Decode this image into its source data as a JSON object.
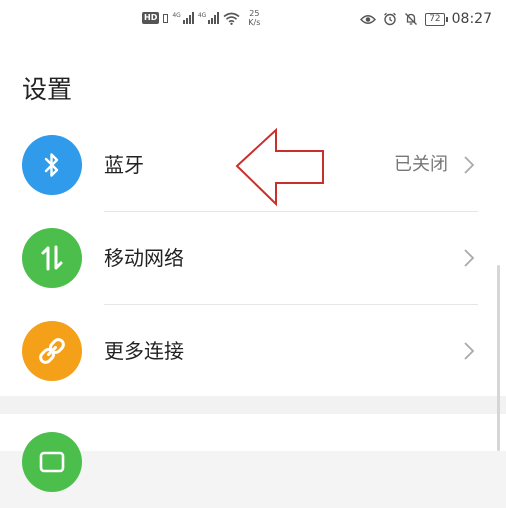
{
  "status_bar": {
    "hd_label": "HD",
    "sim1_label": "4G",
    "sim2_label": "4G",
    "speed_value": "25",
    "speed_unit": "K/s",
    "battery_level": "72",
    "time": "08:27",
    "icons": [
      "hd-icon",
      "signal-icon",
      "wifi-icon",
      "eye-icon",
      "alarm-icon",
      "mute-icon",
      "battery-icon"
    ]
  },
  "page": {
    "title": "设置",
    "items": [
      {
        "label": "蓝牙",
        "value": "已关闭",
        "icon": "bluetooth-icon",
        "icon_color": "#2f9bea"
      },
      {
        "label": "移动网络",
        "value": "",
        "icon": "mobile-data-icon",
        "icon_color": "#4cbe4c"
      },
      {
        "label": "更多连接",
        "value": "",
        "icon": "link-icon",
        "icon_color": "#f5a019"
      },
      {
        "label": "",
        "value": "",
        "icon": "wallpaper-icon",
        "icon_color": "#4cbe4c"
      }
    ]
  },
  "colors": {
    "annotation_arrow": "#c9302c",
    "divider": "#e6e6e6",
    "chevron": "#aaaaaa"
  }
}
